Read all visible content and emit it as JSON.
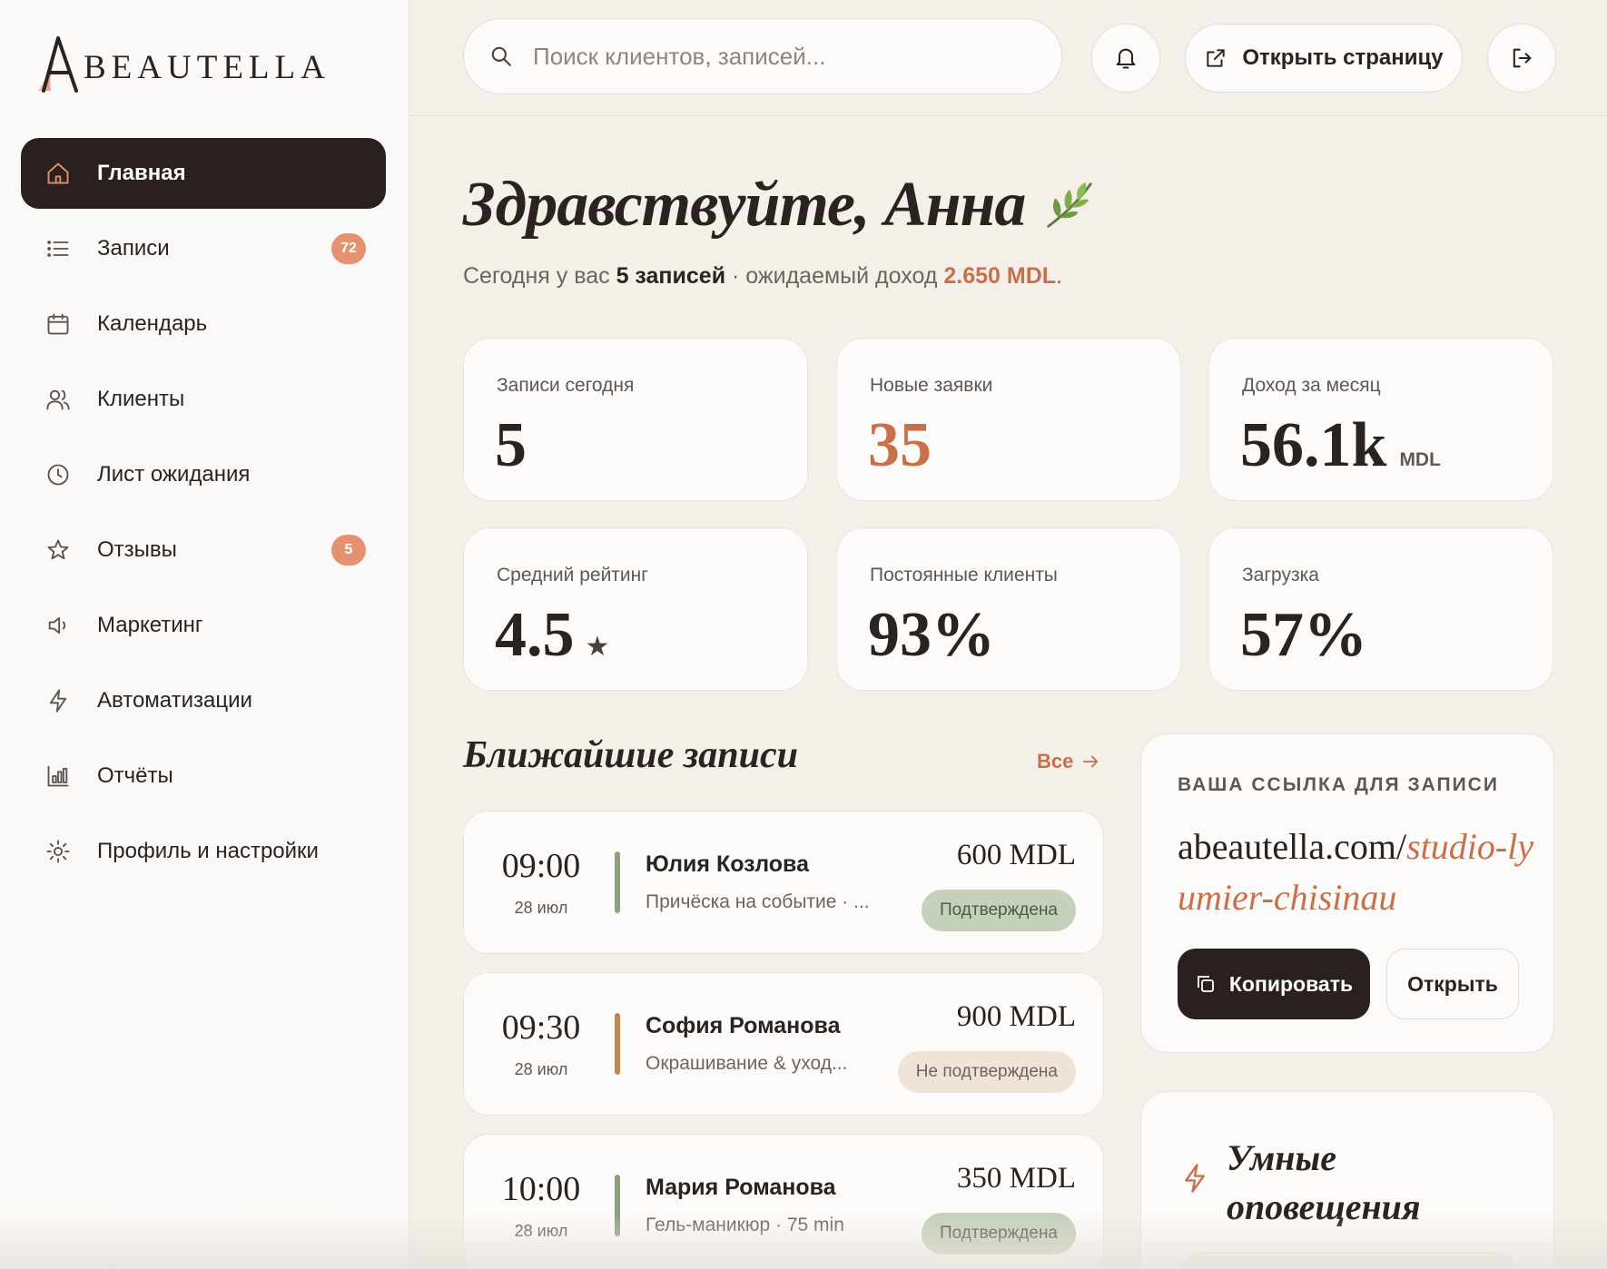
{
  "brand": {
    "logo_text": "BEAUTELLA",
    "accent": "#c8704b",
    "dark": "#2a211e"
  },
  "sidebar": {
    "items": [
      {
        "label": "Главная",
        "icon": "home-icon",
        "active": true,
        "badge": null
      },
      {
        "label": "Записи",
        "icon": "list-icon",
        "active": false,
        "badge": "72"
      },
      {
        "label": "Календарь",
        "icon": "calendar-icon",
        "active": false,
        "badge": null
      },
      {
        "label": "Клиенты",
        "icon": "users-icon",
        "active": false,
        "badge": null
      },
      {
        "label": "Лист ожидания",
        "icon": "clock-icon",
        "active": false,
        "badge": null
      },
      {
        "label": "Отзывы",
        "icon": "star-icon",
        "active": false,
        "badge": "5"
      },
      {
        "label": "Маркетинг",
        "icon": "megaphone-icon",
        "active": false,
        "badge": null
      },
      {
        "label": "Автоматизации",
        "icon": "lightning-icon",
        "active": false,
        "badge": null
      },
      {
        "label": "Отчёты",
        "icon": "bar-chart-icon",
        "active": false,
        "badge": null
      },
      {
        "label": "Профиль и настройки",
        "icon": "gear-icon",
        "active": false,
        "badge": null
      }
    ]
  },
  "topbar": {
    "search_placeholder": "Поиск клиентов, записей...",
    "open_page_label": "Открыть страницу"
  },
  "main": {
    "greeting": "Здравствуйте, Анна",
    "subline": {
      "prefix": "Сегодня у вас ",
      "appointments": "5 записей",
      "middle": " · ожидаемый доход ",
      "income": "2.650 MDL",
      "suffix": "."
    },
    "stats": [
      {
        "label": "Записи сегодня",
        "value": "5",
        "unit": "",
        "accent": false
      },
      {
        "label": "Новые заявки",
        "value": "35",
        "unit": "",
        "accent": true
      },
      {
        "label": "Доход за месяц",
        "value": "56.1k",
        "unit": "MDL",
        "accent": false
      },
      {
        "label": "Средний рейтинг",
        "value": "4.5",
        "unit": "",
        "star": "★",
        "accent": false
      },
      {
        "label": "Постоянные клиенты",
        "value": "93%",
        "unit": "",
        "accent": false
      },
      {
        "label": "Загрузка",
        "value": "57%",
        "unit": "",
        "accent": false
      }
    ],
    "upcoming": {
      "title": "Ближайшие записи",
      "all_label": "Все",
      "items": [
        {
          "time": "09:00",
          "date": "28 июл",
          "name": "Юлия Козлова",
          "service": "Причёска на событие · ...",
          "price": "600 MDL",
          "status": "Подтверждена",
          "confirmed": true,
          "bar_color": "#8fa07f"
        },
        {
          "time": "09:30",
          "date": "28 июл",
          "name": "София Романова",
          "service": "Окрашивание & уход...",
          "price": "900 MDL",
          "status": "Не подтверждена",
          "confirmed": false,
          "bar_color": "#c0884f"
        },
        {
          "time": "10:00",
          "date": "28 июл",
          "name": "Мария Романова",
          "service": "Гель-маникюр · 75 min",
          "price": "350 MDL",
          "status": "Подтверждена",
          "confirmed": true,
          "bar_color": "#8fa07f"
        }
      ]
    },
    "booking_link": {
      "caption": "ВАША ССЫЛКА ДЛЯ ЗАПИСИ",
      "domain": "abeautella.com/",
      "slug": "studio-lyumier-chisinau",
      "copy_label": "Копировать",
      "open_label": "Открыть"
    },
    "smart_alerts": {
      "title": "Умные оповещения"
    }
  }
}
